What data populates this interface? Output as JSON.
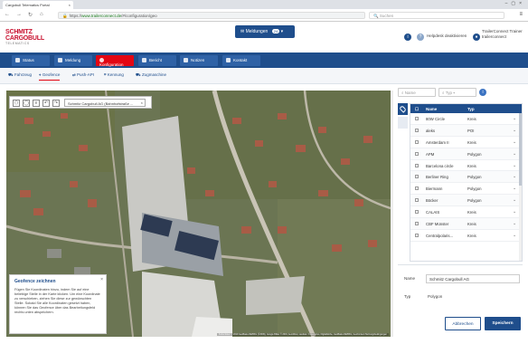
{
  "browser": {
    "tab_title": "Cargobull Telematics Portal",
    "url_host": "www.trailerconnect.de",
    "url_path": "/#/configuration/geo",
    "search_placeholder": "Suchen"
  },
  "header": {
    "logo_line1": "SCHMITZ",
    "logo_line2": "CARGOBULL",
    "logo_line3": "TELEMATICS",
    "notifications_label": "Meldungen",
    "notifications_count": "24",
    "helpdesk_label": "Helpdesk deaktivieren",
    "user_name": "TrailerConnect Trainer",
    "user_account": "trailerconnect"
  },
  "main_nav": [
    {
      "label": "Status",
      "icon": "status-icon",
      "active": false
    },
    {
      "label": "Meldung",
      "icon": "bell-icon",
      "active": false
    },
    {
      "label": "Konfiguration",
      "icon": "gear-icon",
      "active": true
    },
    {
      "label": "Bericht",
      "icon": "report-icon",
      "active": false
    },
    {
      "label": "Notizen",
      "icon": "notes-icon",
      "active": false
    },
    {
      "label": "Kontakt",
      "icon": "contact-icon",
      "active": false
    }
  ],
  "sub_nav": [
    {
      "label": "Fahrzeug",
      "active": false
    },
    {
      "label": "Geofence",
      "active": true
    },
    {
      "label": "Push-API",
      "active": false
    },
    {
      "label": "Kennung",
      "active": false
    },
    {
      "label": "Zugmaschine",
      "active": false
    }
  ],
  "map": {
    "search_value": "Schmitz Cargobull AG (Bahnhofstraße ...",
    "geofence_help_title": "Geofence zeichnen",
    "geofence_help_text": "Fügen Sie Koordinaten hinzu, indem Sie auf eine beliebige Stelle in der Karte klicken. Um eine Koordinate zu verschieben, ziehen Sie diese zur gewünschten Stelle. Sobald Sie alle Koordinaten gesetzt haben, können Sie das Geofence über das Bearbeitungsfeld rechts unten abspeichern.",
    "attribution": "Kartendaten © 2019 GeoBasis-DE/BKG (©2009), Google Bilder © 2019, AeroWest, Landsat / Copernicus, DigitalGlobe, GeoBasis-DE/BKG, GeoContent  Nutzungsbedingungen"
  },
  "panel": {
    "name_filter_placeholder": "Name",
    "type_filter_placeholder": "Typ",
    "column_name": "Name",
    "column_type": "Typ",
    "rows": [
      {
        "name": "80W Circle",
        "type": "Kreis"
      },
      {
        "name": "aleks",
        "type": "POI"
      },
      {
        "name": "Amsterdam II",
        "type": "Kreis"
      },
      {
        "name": "APM",
        "type": "Polygon"
      },
      {
        "name": "Barcelona circle",
        "type": "Kreis"
      },
      {
        "name": "Berliner Ring",
        "type": "Polygon"
      },
      {
        "name": "Biermann",
        "type": "Polygon"
      },
      {
        "name": "Böcker",
        "type": "Polygon"
      },
      {
        "name": "CALAIS",
        "type": "Kreis"
      },
      {
        "name": "CBF Münster",
        "type": "Kreis"
      },
      {
        "name": "Centralpolaris...",
        "type": "Kreis"
      }
    ],
    "detail_name_label": "Name",
    "detail_name_value": "Schmitz Cargobull AG",
    "detail_type_label": "Typ",
    "detail_type_value": "Polygon",
    "cancel_label": "Abbrechen",
    "save_label": "Speichern"
  },
  "colors": {
    "brand_blue": "#1f4e8c",
    "brand_red": "#e30613"
  }
}
